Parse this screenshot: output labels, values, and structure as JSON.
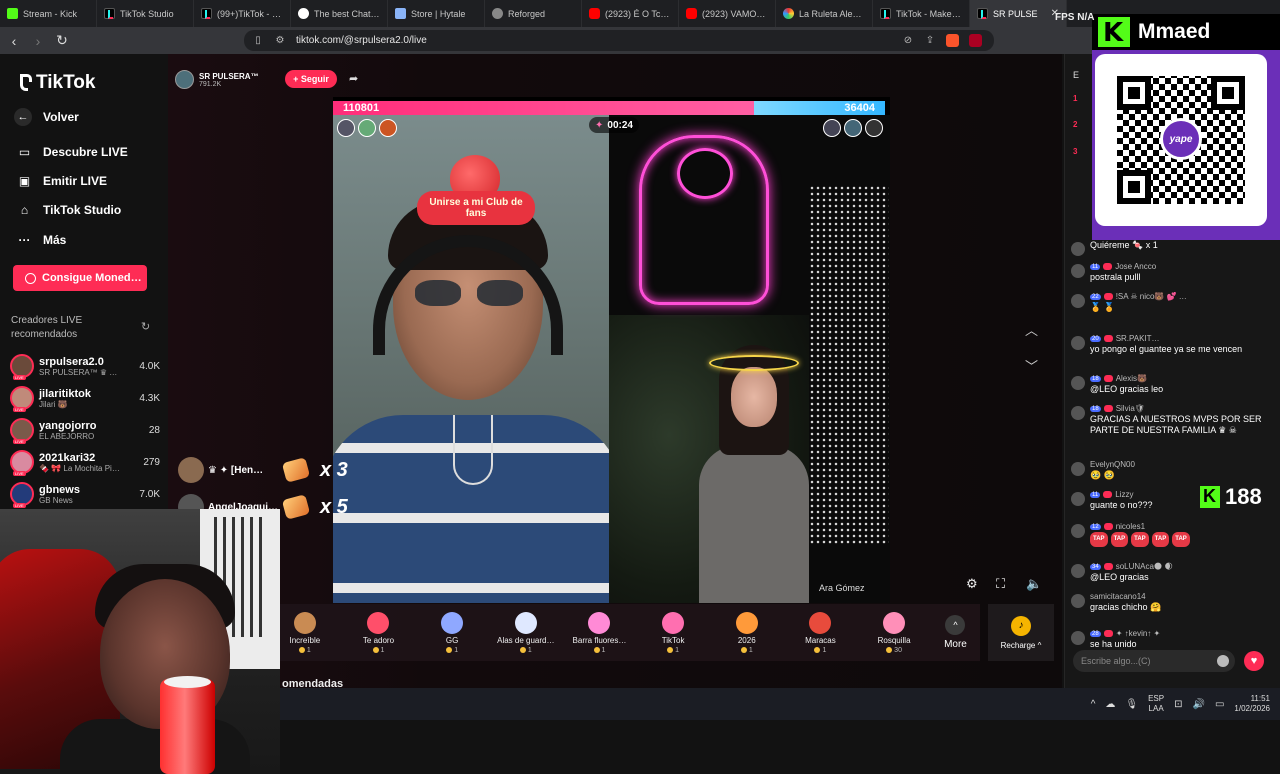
{
  "browser": {
    "tabs": [
      {
        "title": "Stream - Kick",
        "icon": "kick"
      },
      {
        "title": "TikTok Studio",
        "icon": "tt"
      },
      {
        "title": "(99+)TikTok - Ma",
        "icon": "tt"
      },
      {
        "title": "The best ChatBot",
        "icon": "gpt"
      },
      {
        "title": "Store | Hytale",
        "icon": "steam"
      },
      {
        "title": "Reforged",
        "icon": "generic"
      },
      {
        "title": "(2923) É O Tchan",
        "icon": "yt"
      },
      {
        "title": "(2923) VAMONOS",
        "icon": "yt"
      },
      {
        "title": "La Ruleta Aleator",
        "icon": "roul"
      },
      {
        "title": "TikTok - Make Yo",
        "icon": "tt"
      },
      {
        "title": "SR PULSE",
        "icon": "tt",
        "active": true
      }
    ],
    "url": "tiktok.com/@srpulsera2.0/live"
  },
  "sidebar": {
    "logo": "TikTok",
    "back": "Volver",
    "nav": [
      {
        "label": "Descubre LIVE",
        "icon": "live-icon"
      },
      {
        "label": "Emitir LIVE",
        "icon": "camera-icon"
      },
      {
        "label": "TikTok Studio",
        "icon": "home-icon"
      },
      {
        "label": "Más",
        "icon": "more-icon"
      }
    ],
    "coins_button": "Consigue Moned…",
    "recommended_title": "Creadores LIVE recomendados",
    "creators": [
      {
        "name": "srpulsera2.0",
        "sub": "SR PULSERA™ ♛ …",
        "count": "4.0K"
      },
      {
        "name": "jilaritiktok",
        "sub": "Jilari 🐻",
        "count": "4.3K"
      },
      {
        "name": "yangojorro",
        "sub": "EL ABEJORRO",
        "count": "28"
      },
      {
        "name": "2021kari32",
        "sub": "🍫 🎀 La Mochita Pi…",
        "count": "279"
      },
      {
        "name": "gbnews",
        "sub": "GB News",
        "count": "7.0K"
      }
    ]
  },
  "streamer": {
    "name": "SR PULSERA™",
    "viewers": "791.2K",
    "follow": "+ Seguir"
  },
  "battle": {
    "left_score": "110801",
    "right_score": "36404",
    "left_fraction": 0.762,
    "timer": "00:24",
    "club_label": "Unirse a mi Club de fans",
    "opponent_label": "Ara Gómez"
  },
  "combos": [
    {
      "name": "♛ ✦ [Hen…",
      "multiplier": "x 3"
    },
    {
      "name": "AngelJoaqui…",
      "multiplier": "x 5"
    }
  ],
  "gifts": [
    {
      "name": "Increíble",
      "price": "1",
      "color": "#c98b53"
    },
    {
      "name": "Te adoro",
      "price": "1",
      "color": "#ff4f6a"
    },
    {
      "name": "GG",
      "price": "1",
      "color": "#8fa8ff"
    },
    {
      "name": "Alas de guard…",
      "price": "1",
      "color": "#dfe8ff"
    },
    {
      "name": "Barra fluores…",
      "price": "1",
      "color": "#ff8ad6"
    },
    {
      "name": "TikTok",
      "price": "1",
      "color": "#ff6fb0"
    },
    {
      "name": "2026",
      "price": "1",
      "color": "#ff9a3a"
    },
    {
      "name": "Maracas",
      "price": "1",
      "color": "#e84b3c"
    },
    {
      "name": "Rosquilla",
      "price": "30",
      "color": "#ff8fb8"
    }
  ],
  "gift_more": "More",
  "recharge": "Recharge ^",
  "recommended_bottom": "omendadas",
  "chat": {
    "header": "E",
    "ranks": [
      "1",
      "2",
      "3"
    ],
    "messages": [
      {
        "user": "",
        "text": "Quiéreme 🍬 x 1",
        "badge": ""
      },
      {
        "user": "Jose Ancco",
        "text": "postrala pulll",
        "badge": "11"
      },
      {
        "user": "!SA ☠ nico🐻 💕 …",
        "text": "🏅 🏅",
        "badge": "22"
      },
      {
        "user": "SR.PAKIT…",
        "text": "yo pongo el guantee ya se me vencen",
        "badge": "20"
      },
      {
        "user": "Alexis🐻",
        "text": "@LEO gracias leo",
        "badge": "18"
      },
      {
        "user": "Silvia🛡",
        "text": "GRACIAS A NUESTROS MVPS POR SER PARTE DE NUESTRA FAMILIA ♛ ☠",
        "badge": "18"
      },
      {
        "user": "EvelynQN00",
        "text": "🥹 🥹",
        "badge": ""
      },
      {
        "user": "Lizzy",
        "text": "guante o no???",
        "badge": "11"
      },
      {
        "user": "nicoles1",
        "text": "TAP TAP TAP TAP TAP",
        "badge": "12"
      },
      {
        "user": "soLUNAса🌑 🌒",
        "text": "@LEO gracias",
        "badge": "34"
      },
      {
        "user": "samicitacano14",
        "text": "gracias chicho 🤗",
        "badge": ""
      },
      {
        "user": "✦ ↑kevin↑ ✦",
        "text": "se ha unido",
        "badge": "28"
      }
    ],
    "input_placeholder": "Escribe algo...(C)"
  },
  "overlay": {
    "kick_name": "Mmaed",
    "kick_count": "188",
    "yape": "yape",
    "fps": "FPS N/A",
    "fps_right": "N/A"
  },
  "taskbar": {
    "lang1": "ESP",
    "lang2": "LAA",
    "time": "11:51",
    "date": "1/02/2026"
  },
  "colors": {
    "brand_pink": "#fe2c55",
    "kick_green": "#53fc18",
    "yape_purple": "#6b2fb8"
  }
}
